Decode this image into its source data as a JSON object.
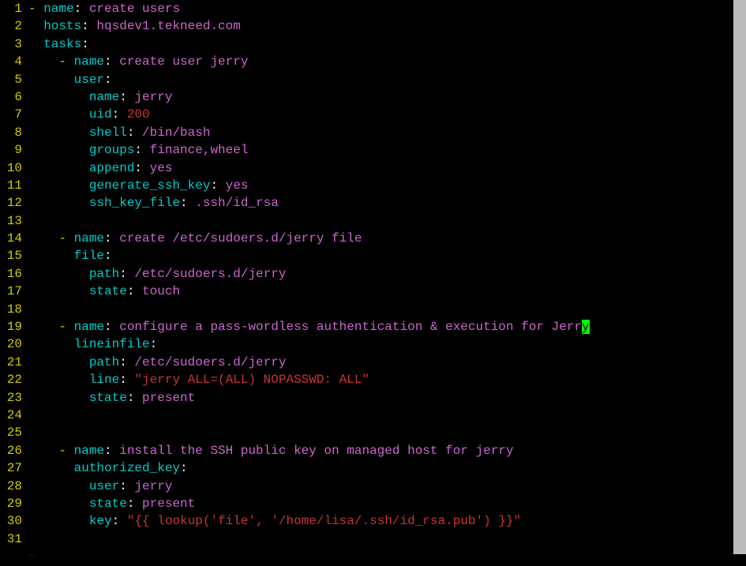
{
  "lines": [
    {
      "num": "1",
      "segments": [
        {
          "t": "- ",
          "c": "dash"
        },
        {
          "t": "name",
          "c": "key"
        },
        {
          "t": ":",
          "c": "colon"
        },
        {
          "t": " create users",
          "c": "str"
        }
      ]
    },
    {
      "num": "2",
      "segments": [
        {
          "t": "  ",
          "c": ""
        },
        {
          "t": "hosts",
          "c": "key"
        },
        {
          "t": ":",
          "c": "colon"
        },
        {
          "t": " hqsdev1.tekneed.com",
          "c": "str"
        }
      ]
    },
    {
      "num": "3",
      "segments": [
        {
          "t": "  ",
          "c": ""
        },
        {
          "t": "tasks",
          "c": "key"
        },
        {
          "t": ":",
          "c": "colon"
        }
      ]
    },
    {
      "num": "4",
      "segments": [
        {
          "t": "    ",
          "c": ""
        },
        {
          "t": "- ",
          "c": "dash"
        },
        {
          "t": "name",
          "c": "key"
        },
        {
          "t": ":",
          "c": "colon"
        },
        {
          "t": " create user jerry",
          "c": "str"
        }
      ]
    },
    {
      "num": "5",
      "segments": [
        {
          "t": "      ",
          "c": ""
        },
        {
          "t": "user",
          "c": "key"
        },
        {
          "t": ":",
          "c": "colon"
        }
      ]
    },
    {
      "num": "6",
      "segments": [
        {
          "t": "        ",
          "c": ""
        },
        {
          "t": "name",
          "c": "key"
        },
        {
          "t": ":",
          "c": "colon"
        },
        {
          "t": " jerry",
          "c": "str"
        }
      ]
    },
    {
      "num": "7",
      "segments": [
        {
          "t": "        ",
          "c": ""
        },
        {
          "t": "uid",
          "c": "key"
        },
        {
          "t": ":",
          "c": "colon"
        },
        {
          "t": " 200",
          "c": "num"
        }
      ]
    },
    {
      "num": "8",
      "segments": [
        {
          "t": "        ",
          "c": ""
        },
        {
          "t": "shell",
          "c": "key"
        },
        {
          "t": ":",
          "c": "colon"
        },
        {
          "t": " /bin/bash",
          "c": "str"
        }
      ]
    },
    {
      "num": "9",
      "segments": [
        {
          "t": "        ",
          "c": ""
        },
        {
          "t": "groups",
          "c": "key"
        },
        {
          "t": ":",
          "c": "colon"
        },
        {
          "t": " finance,wheel",
          "c": "str"
        }
      ]
    },
    {
      "num": "10",
      "segments": [
        {
          "t": "        ",
          "c": ""
        },
        {
          "t": "append",
          "c": "key"
        },
        {
          "t": ":",
          "c": "colon"
        },
        {
          "t": " yes",
          "c": "str"
        }
      ]
    },
    {
      "num": "11",
      "segments": [
        {
          "t": "        ",
          "c": ""
        },
        {
          "t": "generate_ssh_key",
          "c": "key"
        },
        {
          "t": ":",
          "c": "colon"
        },
        {
          "t": " yes",
          "c": "str"
        }
      ]
    },
    {
      "num": "12",
      "segments": [
        {
          "t": "        ",
          "c": ""
        },
        {
          "t": "ssh_key_file",
          "c": "key"
        },
        {
          "t": ":",
          "c": "colon"
        },
        {
          "t": " .ssh/id_rsa",
          "c": "str"
        }
      ]
    },
    {
      "num": "13",
      "segments": []
    },
    {
      "num": "14",
      "segments": [
        {
          "t": "    ",
          "c": ""
        },
        {
          "t": "- ",
          "c": "dash"
        },
        {
          "t": "name",
          "c": "key"
        },
        {
          "t": ":",
          "c": "colon"
        },
        {
          "t": " create /etc/sudoers.d/jerry file",
          "c": "str"
        }
      ]
    },
    {
      "num": "15",
      "segments": [
        {
          "t": "      ",
          "c": ""
        },
        {
          "t": "file",
          "c": "key"
        },
        {
          "t": ":",
          "c": "colon"
        }
      ]
    },
    {
      "num": "16",
      "segments": [
        {
          "t": "        ",
          "c": ""
        },
        {
          "t": "path",
          "c": "key"
        },
        {
          "t": ":",
          "c": "colon"
        },
        {
          "t": " /etc/sudoers.d/jerry",
          "c": "str"
        }
      ]
    },
    {
      "num": "17",
      "segments": [
        {
          "t": "        ",
          "c": ""
        },
        {
          "t": "state",
          "c": "key"
        },
        {
          "t": ":",
          "c": "colon"
        },
        {
          "t": " touch",
          "c": "str"
        }
      ]
    },
    {
      "num": "18",
      "segments": []
    },
    {
      "num": "19",
      "segments": [
        {
          "t": "    ",
          "c": ""
        },
        {
          "t": "- ",
          "c": "dash"
        },
        {
          "t": "name",
          "c": "key"
        },
        {
          "t": ":",
          "c": "colon"
        },
        {
          "t": " configure a pass-wordless authentication & execution for Jerr",
          "c": "str"
        },
        {
          "t": "y",
          "c": "cursor-bg"
        }
      ]
    },
    {
      "num": "20",
      "segments": [
        {
          "t": "      ",
          "c": ""
        },
        {
          "t": "lineinfile",
          "c": "key"
        },
        {
          "t": ":",
          "c": "colon"
        }
      ]
    },
    {
      "num": "21",
      "segments": [
        {
          "t": "        ",
          "c": ""
        },
        {
          "t": "path",
          "c": "key"
        },
        {
          "t": ":",
          "c": "colon"
        },
        {
          "t": " /etc/sudoers.d/jerry",
          "c": "str"
        }
      ]
    },
    {
      "num": "22",
      "segments": [
        {
          "t": "        ",
          "c": ""
        },
        {
          "t": "line",
          "c": "key"
        },
        {
          "t": ":",
          "c": "colon"
        },
        {
          "t": " \"jerry ALL=(ALL) NOPASSWD: ALL\"",
          "c": "quoted"
        }
      ]
    },
    {
      "num": "23",
      "segments": [
        {
          "t": "        ",
          "c": ""
        },
        {
          "t": "state",
          "c": "key"
        },
        {
          "t": ":",
          "c": "colon"
        },
        {
          "t": " present",
          "c": "str"
        }
      ]
    },
    {
      "num": "24",
      "segments": []
    },
    {
      "num": "25",
      "segments": []
    },
    {
      "num": "26",
      "segments": [
        {
          "t": "    ",
          "c": ""
        },
        {
          "t": "- ",
          "c": "dash"
        },
        {
          "t": "name",
          "c": "key"
        },
        {
          "t": ":",
          "c": "colon"
        },
        {
          "t": " install the SSH public key on managed host for jerry",
          "c": "str"
        }
      ]
    },
    {
      "num": "27",
      "segments": [
        {
          "t": "      ",
          "c": ""
        },
        {
          "t": "authorized_key",
          "c": "key"
        },
        {
          "t": ":",
          "c": "colon"
        }
      ]
    },
    {
      "num": "28",
      "segments": [
        {
          "t": "        ",
          "c": ""
        },
        {
          "t": "user",
          "c": "key"
        },
        {
          "t": ":",
          "c": "colon"
        },
        {
          "t": " jerry",
          "c": "str"
        }
      ]
    },
    {
      "num": "29",
      "segments": [
        {
          "t": "        ",
          "c": ""
        },
        {
          "t": "state",
          "c": "key"
        },
        {
          "t": ":",
          "c": "colon"
        },
        {
          "t": " present",
          "c": "str"
        }
      ]
    },
    {
      "num": "30",
      "segments": [
        {
          "t": "        ",
          "c": ""
        },
        {
          "t": "key",
          "c": "key"
        },
        {
          "t": ":",
          "c": "colon"
        },
        {
          "t": " \"{{ lookup('file', '/home/lisa/.ssh/id_rsa.pub') }}\"",
          "c": "quoted"
        }
      ]
    },
    {
      "num": "31",
      "segments": []
    }
  ],
  "tilde": "~"
}
